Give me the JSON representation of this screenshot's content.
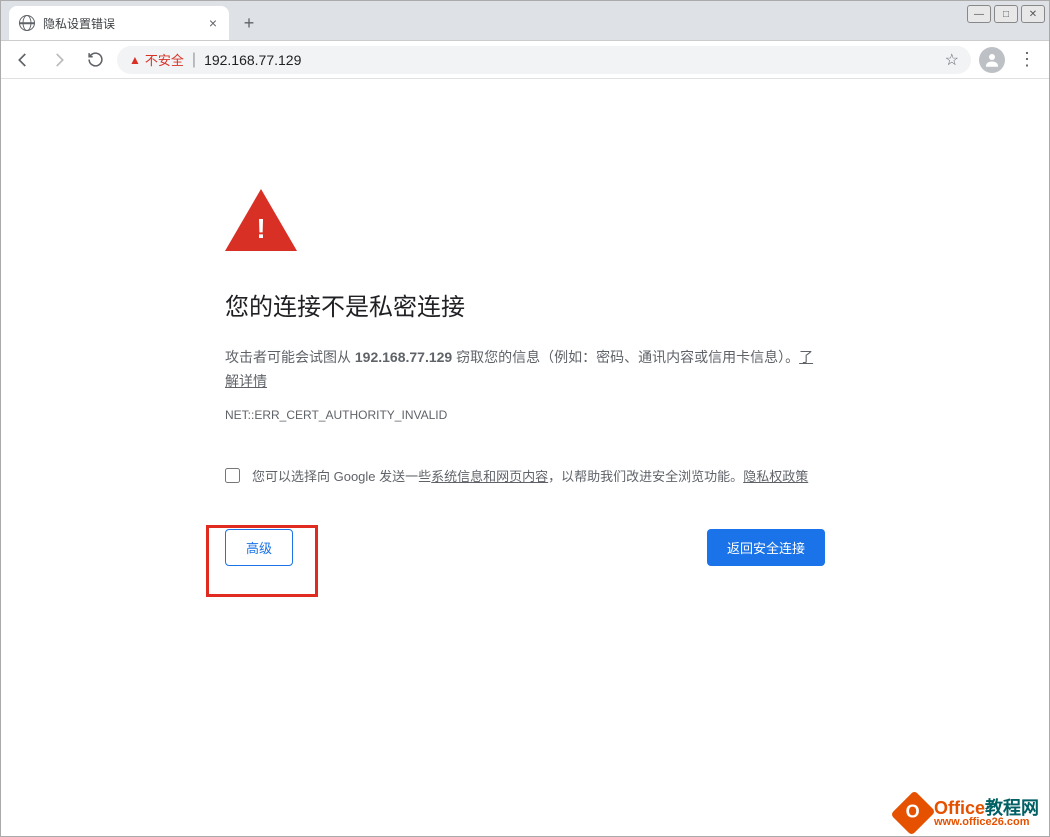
{
  "window": {
    "tab_title": "隐私设置错误",
    "controls": {
      "min": "—",
      "max": "□",
      "close": "✕"
    },
    "new_tab": "+",
    "tab_close": "×"
  },
  "toolbar": {
    "security_label": "不安全",
    "divider": "|",
    "url": "192.168.77.129"
  },
  "page": {
    "heading": "您的连接不是私密连接",
    "desc_prefix": "攻击者可能会试图从 ",
    "desc_host": "192.168.77.129",
    "desc_suffix": " 窃取您的信息（例如：密码、通讯内容或信用卡信息）。",
    "learn_more": "了解详情",
    "error_code": "NET::ERR_CERT_AUTHORITY_INVALID",
    "opt_prefix": "您可以选择向 Google 发送一些",
    "opt_link": "系统信息和网页内容",
    "opt_suffix": "，以帮助我们改进安全浏览功能。",
    "privacy_link": "隐私权政策",
    "advanced_btn": "高级",
    "back_btn": "返回安全连接"
  },
  "watermark": {
    "title": "Office教程网",
    "url": "www.office26.com",
    "badge": "O"
  }
}
